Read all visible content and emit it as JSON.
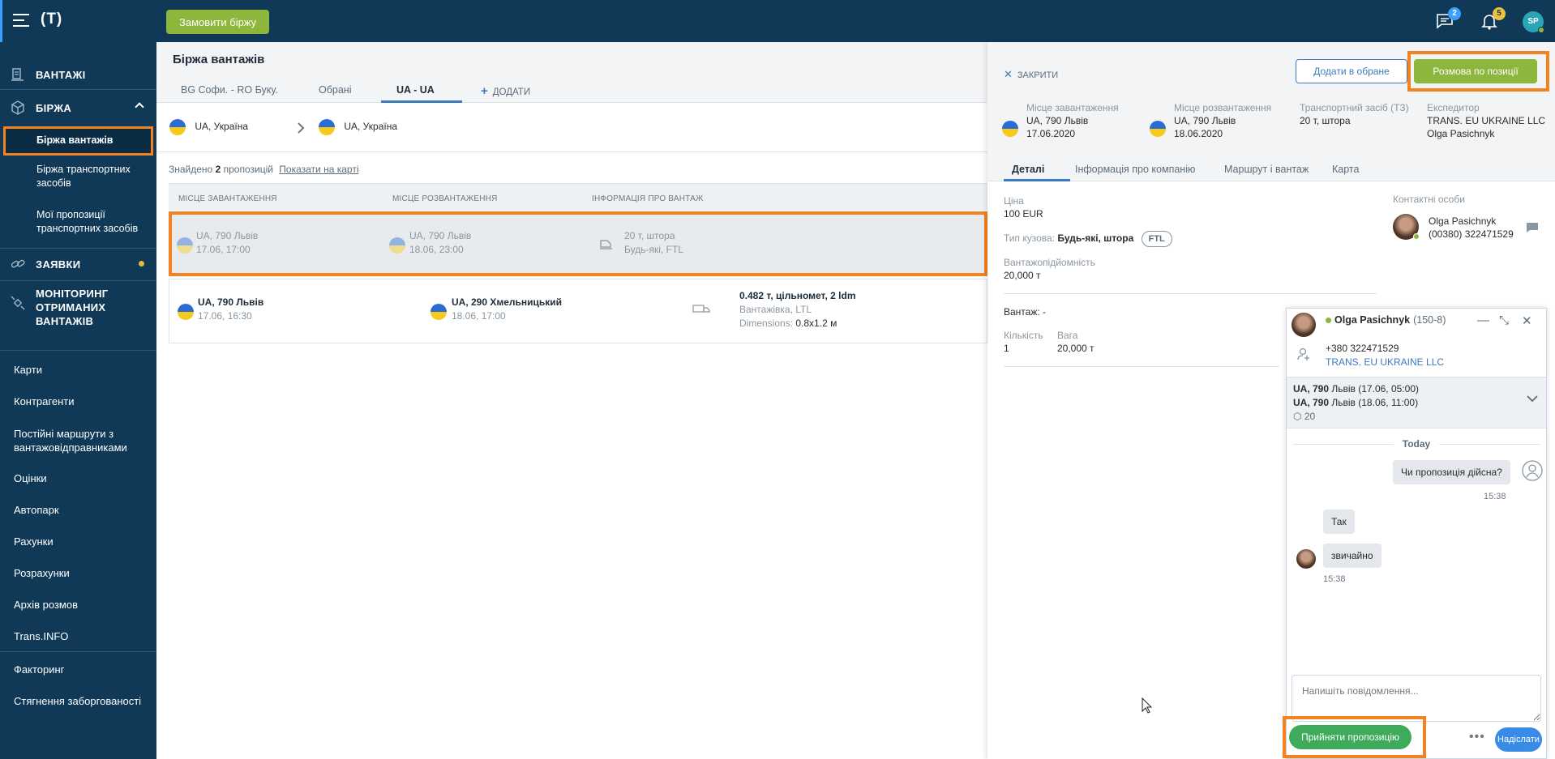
{
  "topbar": {
    "logo": "(T)",
    "order_button": "Замовити біржу",
    "messages_count": "2",
    "notifications_count": "5",
    "user_initials": "SP"
  },
  "sidebar": {
    "main_items": [
      {
        "label": "ВАНТАЖІ",
        "icon": "cargo-icon"
      },
      {
        "label": "БІРЖА",
        "icon": "cube-icon"
      },
      {
        "label": "ЗАЯВКИ",
        "icon": "link-icon"
      },
      {
        "label": "МОНІТОРИНГ ОТРИМАНИХ ВАНТАЖІВ",
        "icon": "satellite-icon"
      }
    ],
    "sub_items": [
      "Біржа вантажів",
      "Біржа транспортних засобів",
      "Мої пропозиції транспортних засобів"
    ],
    "links": [
      "Карти",
      "Контрагенти",
      "Постійні маршрути з вантажовідправниками",
      "Оцінки",
      "Автопарк",
      "Рахунки",
      "Розрахунки",
      "Архів розмов",
      "Trans.INFO",
      "Факторинг",
      "Стягнення заборгованості"
    ]
  },
  "main": {
    "title": "Біржа вантажів",
    "tabs": [
      "BG Софи. - RO Буку.",
      "Обрані",
      "UA - UA"
    ],
    "add_tab": "ДОДАТИ",
    "filter_from": "UA, Україна",
    "filter_to": "UA, Україна",
    "found_prefix": "Знайдено",
    "found_count": "2",
    "found_suffix": "пропозицій",
    "show_map": "Показати на карті",
    "columns": [
      "МІСЦЕ ЗАВАНТАЖЕННЯ",
      "МІСЦЕ РОЗВАНТАЖЕННЯ",
      "ІНФОРМАЦІЯ ПРО ВАНТАЖ"
    ],
    "rows": [
      {
        "load_place": "UA, 790 Львів",
        "load_time": "17.06, 17:00",
        "unload_place": "UA, 790 Львів",
        "unload_time": "18.06, 23:00",
        "cargo_main": "20 т, штора",
        "cargo_sub": "Будь-які, FTL",
        "cargo_dims_label": "",
        "cargo_dims": ""
      },
      {
        "load_place": "UA, 790 Львів",
        "load_time": "17.06, 16:30",
        "unload_place": "UA, 290 Хмельницький",
        "unload_time": "18.06, 17:00",
        "cargo_main": "0.482 т, цільномет, 2 ldm",
        "cargo_sub": "Вантажівка, LTL",
        "cargo_dims_label": "Dimensions:",
        "cargo_dims": "0.8x1.2 м"
      }
    ]
  },
  "detail": {
    "close": "ЗАКРИТИ",
    "add_favorite": "Додати в обране",
    "chat_offer": "Розмова по позиції",
    "load": {
      "label": "Місце завантаження",
      "place": "UA, 790 Львів",
      "date": "17.06.2020"
    },
    "unload": {
      "label": "Місце розвантаження",
      "place": "UA, 790 Львів",
      "date": "18.06.2020"
    },
    "vehicle": {
      "label": "Транспортний засіб (ТЗ)",
      "value": "20 т, штора"
    },
    "forwarder": {
      "label": "Експедитор",
      "company": "TRANS. EU UKRAINE LLC",
      "person": "Olga Pasichnyk"
    },
    "tabs": [
      "Деталі",
      "Інформація про компанію",
      "Маршрут і вантаж",
      "Карта"
    ],
    "price_label": "Ціна",
    "price": "100 EUR",
    "body_label": "Тип кузова:",
    "body_value": "Будь-які, штора",
    "body_pill": "FTL",
    "capacity_label": "Вантажопідйомність",
    "capacity": "20,000 т",
    "cargo_label": "Вантаж: -",
    "qty_label": "Кількість",
    "qty": "1",
    "weight_label": "Вага",
    "weight": "20,000 т",
    "contacts_label": "Контактні особи",
    "contact_name": "Olga Pasichnyk",
    "contact_phone": "(00380) 322471529"
  },
  "chat": {
    "name": "Olga Pasichnyk",
    "id": "(150-8)",
    "phone": "+380 322471529",
    "company": "TRANS. EU UKRAINE LLC",
    "route1_place": "UA, 790",
    "route1_city": "Львів",
    "route1_time": "(17.06, 05:00)",
    "route2_place": "UA, 790",
    "route2_city": "Львів",
    "route2_time": "(18.06, 11:00)",
    "route_weight": "20",
    "day": "Today",
    "messages": [
      {
        "text": "Чи пропозиція дійсна?",
        "time": "15:38"
      },
      {
        "text": "Так",
        "time": ""
      },
      {
        "text": "звичайно",
        "time": "15:38"
      }
    ],
    "input_placeholder": "Напишіть повідомлення...",
    "accept": "Прийняти пропозицію",
    "send": "Надіслати"
  },
  "colors": {
    "navy": "#0f3956",
    "green": "#8db63d",
    "orange_highlight": "#f58220",
    "blue": "#3a7bbf"
  }
}
